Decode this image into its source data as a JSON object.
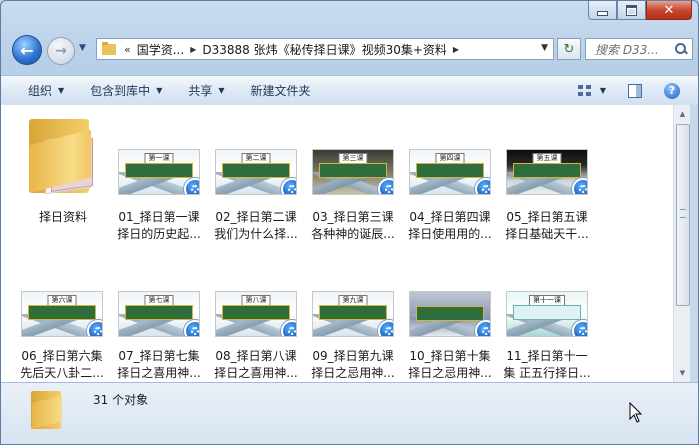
{
  "window": {
    "caption": {
      "minimize_label": "",
      "maximize_label": "",
      "close_label": "✕"
    }
  },
  "nav": {
    "back_glyph": "←",
    "forward_glyph": "→",
    "history_glyph": "▼",
    "breadcrumb": {
      "overflow": "«",
      "items": [
        "国学资...",
        "D33888 张炜《秘传择日课》视频30集+资料"
      ],
      "separator": "▶"
    },
    "address_dropdown_glyph": "▼",
    "refresh_glyph": "↻",
    "search_placeholder": "搜索 D33..."
  },
  "toolbar": {
    "items": [
      {
        "label": "组织",
        "has_dropdown": true
      },
      {
        "label": "包含到库中",
        "has_dropdown": true
      },
      {
        "label": "共享",
        "has_dropdown": true
      },
      {
        "label": "新建文件夹",
        "has_dropdown": false
      }
    ],
    "view_arrow": "▼",
    "help_glyph": "?"
  },
  "items": [
    {
      "kind": "folder",
      "line1": "择日资料",
      "line2": ""
    },
    {
      "kind": "video",
      "line1": "01_择日第一课",
      "line2": "择日的历史起...",
      "tag": "第一课",
      "style": ""
    },
    {
      "kind": "video",
      "line1": "02_择日第二课",
      "line2": "我们为什么择...",
      "tag": "第二课",
      "style": ""
    },
    {
      "kind": "video",
      "line1": "03_择日第三课",
      "line2": "各种神的诞辰...",
      "tag": "第三课",
      "style": "dark"
    },
    {
      "kind": "video",
      "line1": "04_择日第四课",
      "line2": "择日使用用的...",
      "tag": "第四课",
      "style": ""
    },
    {
      "kind": "video",
      "line1": "05_择日第五课",
      "line2": "择日基础天干...",
      "tag": "第五课",
      "style": "black"
    },
    {
      "kind": "video",
      "line1": "06_择日第六集",
      "line2": "先后天八卦二...",
      "tag": "第六课",
      "style": ""
    },
    {
      "kind": "video",
      "line1": "07_择日第七集",
      "line2": "择日之喜用神...",
      "tag": "第七课",
      "style": ""
    },
    {
      "kind": "video",
      "line1": "08_择日第八课",
      "line2": "择日之喜用神...",
      "tag": "第八课",
      "style": ""
    },
    {
      "kind": "video",
      "line1": "09_择日第九课",
      "line2": "择日之忌用神...",
      "tag": "第九课",
      "style": ""
    },
    {
      "kind": "video",
      "line1": "10_择日第十集",
      "line2": "择日之忌用神...",
      "tag": "",
      "style": "purple"
    },
    {
      "kind": "video",
      "line1": "11_择日第十一",
      "line2": "集 正五行择日...",
      "tag": "第十一课",
      "style": "teal"
    }
  ],
  "status": {
    "count_text": "31 个对象"
  }
}
